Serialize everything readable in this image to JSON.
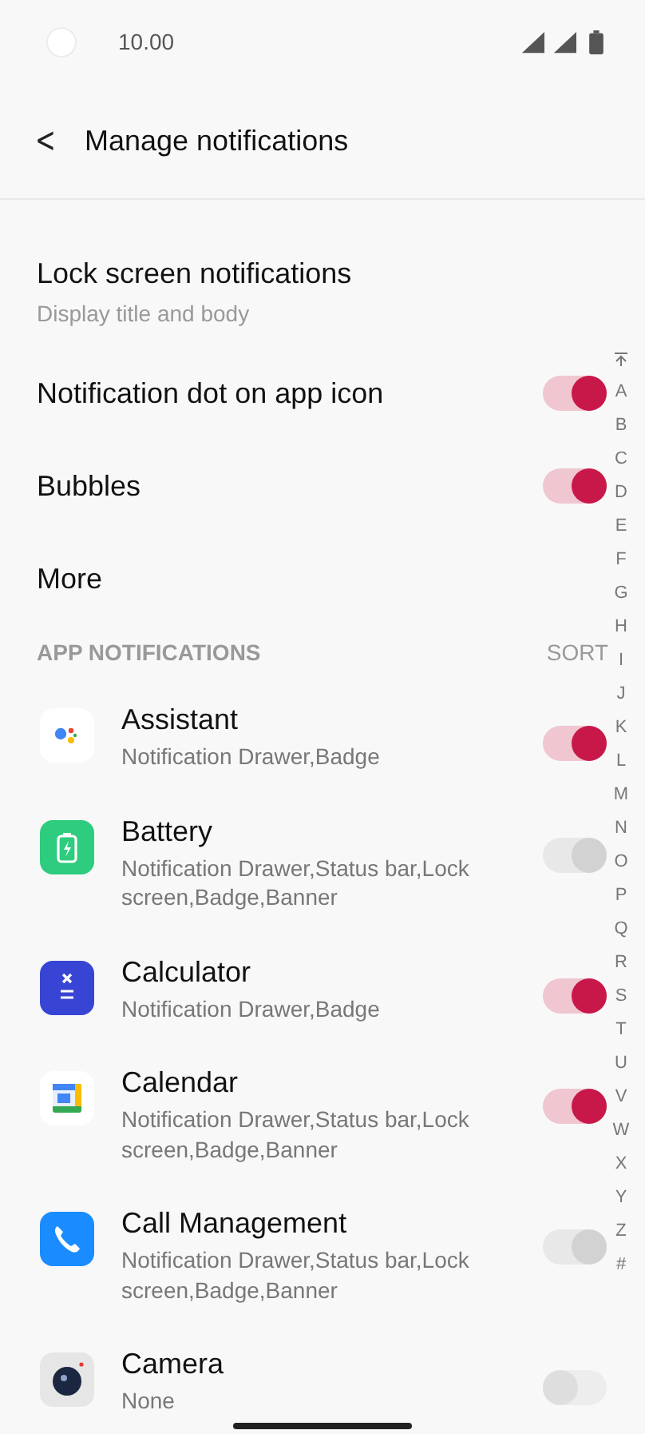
{
  "status_bar": {
    "time": "10.00"
  },
  "header": {
    "back": "<",
    "title": "Manage notifications"
  },
  "settings": [
    {
      "kind": "detail",
      "label": "Lock screen notifications",
      "value": "Display title and body"
    },
    {
      "kind": "toggle",
      "label": "Notification dot on app icon",
      "on": true
    },
    {
      "kind": "toggle",
      "label": "Bubbles",
      "on": true
    },
    {
      "kind": "link",
      "label": "More"
    }
  ],
  "app_section": {
    "title": "APP NOTIFICATIONS",
    "sort": "SORT"
  },
  "apps": [
    {
      "name": "Assistant",
      "kind": "assistant",
      "detail": "Notification Drawer,Badge",
      "on": true,
      "disabled": false
    },
    {
      "name": "Battery",
      "kind": "battery",
      "detail": "Notification Drawer,Status bar,Lock screen,Badge,Banner",
      "on": true,
      "disabled": true
    },
    {
      "name": "Calculator",
      "kind": "calculator",
      "detail": "Notification Drawer,Badge",
      "on": true,
      "disabled": false
    },
    {
      "name": "Calendar",
      "kind": "calendar",
      "detail": "Notification Drawer,Status bar,Lock screen,Badge,Banner",
      "on": true,
      "disabled": false
    },
    {
      "name": "Call Management",
      "kind": "phone",
      "detail": "Notification Drawer,Status bar,Lock screen,Badge,Banner",
      "on": true,
      "disabled": true
    },
    {
      "name": "Camera",
      "kind": "camera",
      "detail": "None",
      "on": false,
      "disabled": false
    }
  ],
  "index": [
    "A",
    "B",
    "C",
    "D",
    "E",
    "F",
    "G",
    "H",
    "I",
    "J",
    "K",
    "L",
    "M",
    "N",
    "O",
    "P",
    "Q",
    "R",
    "S",
    "T",
    "U",
    "V",
    "W",
    "X",
    "Y",
    "Z",
    "#"
  ]
}
